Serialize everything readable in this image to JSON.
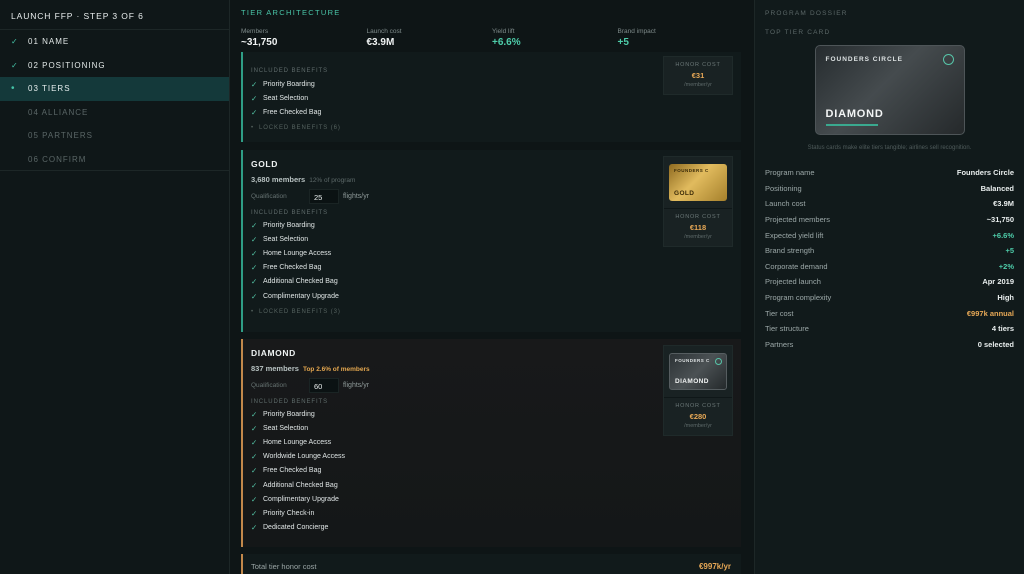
{
  "sidebar": {
    "title": "LAUNCH FFP · STEP 3 OF 6",
    "steps": [
      {
        "mark": "✓",
        "label": "01 NAME"
      },
      {
        "mark": "✓",
        "label": "02 POSITIONING"
      },
      {
        "mark": "•",
        "label": "03 TIERS"
      },
      {
        "mark": "",
        "label": "04 ALLIANCE"
      },
      {
        "mark": "",
        "label": "05 PARTNERS"
      },
      {
        "mark": "",
        "label": "06 CONFIRM"
      }
    ]
  },
  "main": {
    "section_label": "TIER ARCHITECTURE",
    "stats": [
      {
        "label": "Members",
        "value": "~31,750"
      },
      {
        "label": "Launch cost",
        "value": "€3.9M"
      },
      {
        "label": "Yield lift",
        "value": "+6.6%"
      },
      {
        "label": "Brand impact",
        "value": "+5"
      }
    ],
    "included_label": "INCLUDED BENEFITS",
    "honor_cost_label": "HONOR COST",
    "qualification_label": "Qualification",
    "qualification_unit": "flights/yr",
    "per_member": "/member/yr",
    "tiers": [
      {
        "benefits": [
          "Priority Boarding",
          "Seat Selection",
          "Free Checked Bag"
        ],
        "locked": "LOCKED BENEFITS (6)",
        "honor_cost": "€31"
      },
      {
        "name": "GOLD",
        "members": "3,680 members",
        "pct": "12% of program",
        "qualification": "25",
        "benefits": [
          "Priority Boarding",
          "Seat Selection",
          "Home Lounge Access",
          "Free Checked Bag",
          "Additional Checked Bag",
          "Complimentary Upgrade"
        ],
        "locked": "LOCKED BENEFITS (3)",
        "card_brand": "FOUNDERS C",
        "card_tier": "GOLD",
        "honor_cost": "€118"
      },
      {
        "name": "DIAMOND",
        "members": "837 members",
        "pct": "Top 2.6% of members",
        "qualification": "60",
        "benefits": [
          "Priority Boarding",
          "Seat Selection",
          "Home Lounge Access",
          "Worldwide Lounge Access",
          "Free Checked Bag",
          "Additional Checked Bag",
          "Complimentary Upgrade",
          "Priority Check-in",
          "Dedicated Concierge"
        ],
        "card_brand": "FOUNDERS C",
        "card_tier": "DIAMOND",
        "honor_cost": "€280"
      }
    ],
    "total": {
      "label": "Total tier honor cost",
      "value": "€997k/yr"
    }
  },
  "dossier": {
    "label": "PROGRAM DOSSIER",
    "card_label": "TOP TIER CARD",
    "card_brand": "FOUNDERS CIRCLE",
    "card_tier": "DIAMOND",
    "caption": "Status cards make elite tiers tangible; airlines sell recognition.",
    "rows": [
      {
        "k": "Program name",
        "v": "Founders Circle"
      },
      {
        "k": "Positioning",
        "v": "Balanced"
      },
      {
        "k": "Launch cost",
        "v": "€3.9M"
      },
      {
        "k": "Projected members",
        "v": "~31,750"
      },
      {
        "k": "Expected yield lift",
        "v": "+6.6%"
      },
      {
        "k": "Brand strength",
        "v": "+5"
      },
      {
        "k": "Corporate demand",
        "v": "+2%"
      },
      {
        "k": "Projected launch",
        "v": "Apr 2019"
      },
      {
        "k": "Program complexity",
        "v": "High"
      },
      {
        "k": "Tier cost",
        "v": "€997k annual"
      },
      {
        "k": "Tier structure",
        "v": "4 tiers"
      },
      {
        "k": "Partners",
        "v": "0 selected"
      }
    ]
  },
  "colors": {
    "accent": "#49c5a8",
    "warning": "#e7a856",
    "background": "#0e1516"
  }
}
